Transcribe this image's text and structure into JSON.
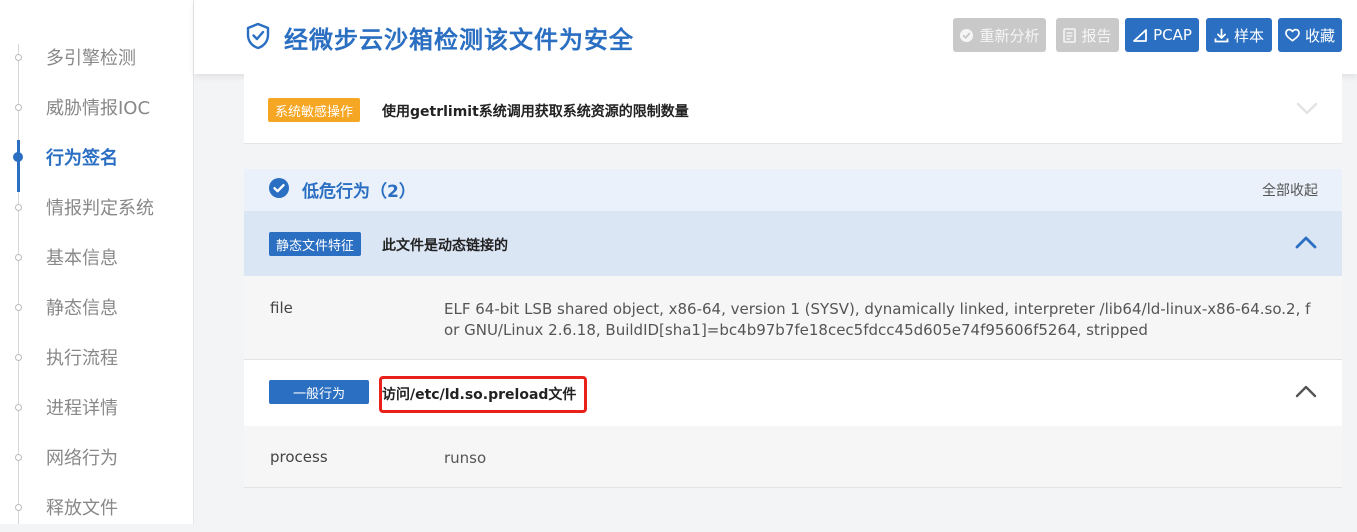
{
  "sidebar": {
    "items": [
      {
        "label": "多引擎检测",
        "active": false
      },
      {
        "label": "威胁情报IOC",
        "active": false
      },
      {
        "label": "行为签名",
        "active": true
      },
      {
        "label": "情报判定系统",
        "active": false
      },
      {
        "label": "基本信息",
        "active": false
      },
      {
        "label": "静态信息",
        "active": false
      },
      {
        "label": "执行流程",
        "active": false
      },
      {
        "label": "进程详情",
        "active": false
      },
      {
        "label": "网络行为",
        "active": false
      },
      {
        "label": "释放文件",
        "active": false
      }
    ]
  },
  "header": {
    "icon": "shield-check-icon",
    "title": "经微步云沙箱检测该文件为安全",
    "buttons": {
      "reanalyze": "重新分析",
      "report": "报告",
      "pcap": "PCAP",
      "sample": "样本",
      "favorite": "收藏"
    }
  },
  "behaviors": {
    "sensitive_row": {
      "tag": "系统敏感操作",
      "title": "使用getrlimit系统调用获取系统资源的限制数量"
    },
    "low_risk": {
      "title": "低危行为（2）",
      "collapse_all": "全部收起"
    },
    "static_row": {
      "tag": "静态文件特征",
      "title": "此文件是动态链接的",
      "key": "file",
      "value": "ELF 64-bit LSB shared object, x86-64, version 1 (SYSV), dynamically linked, interpreter /lib64/ld-linux-x86-64.so.2, for GNU/Linux 2.6.18, BuildID[sha1]=bc4b97b7fe18cec5fdcc45d605e74f95606f5264, stripped"
    },
    "general_row": {
      "tag": "一般行为",
      "title": "访问/etc/ld.so.preload文件",
      "key": "process",
      "value": "runso"
    }
  },
  "colors": {
    "brand": "#2b6fc2",
    "tag_orange": "#f5a623",
    "highlight": "#e8221b",
    "disabled": "#c9c9c9"
  }
}
